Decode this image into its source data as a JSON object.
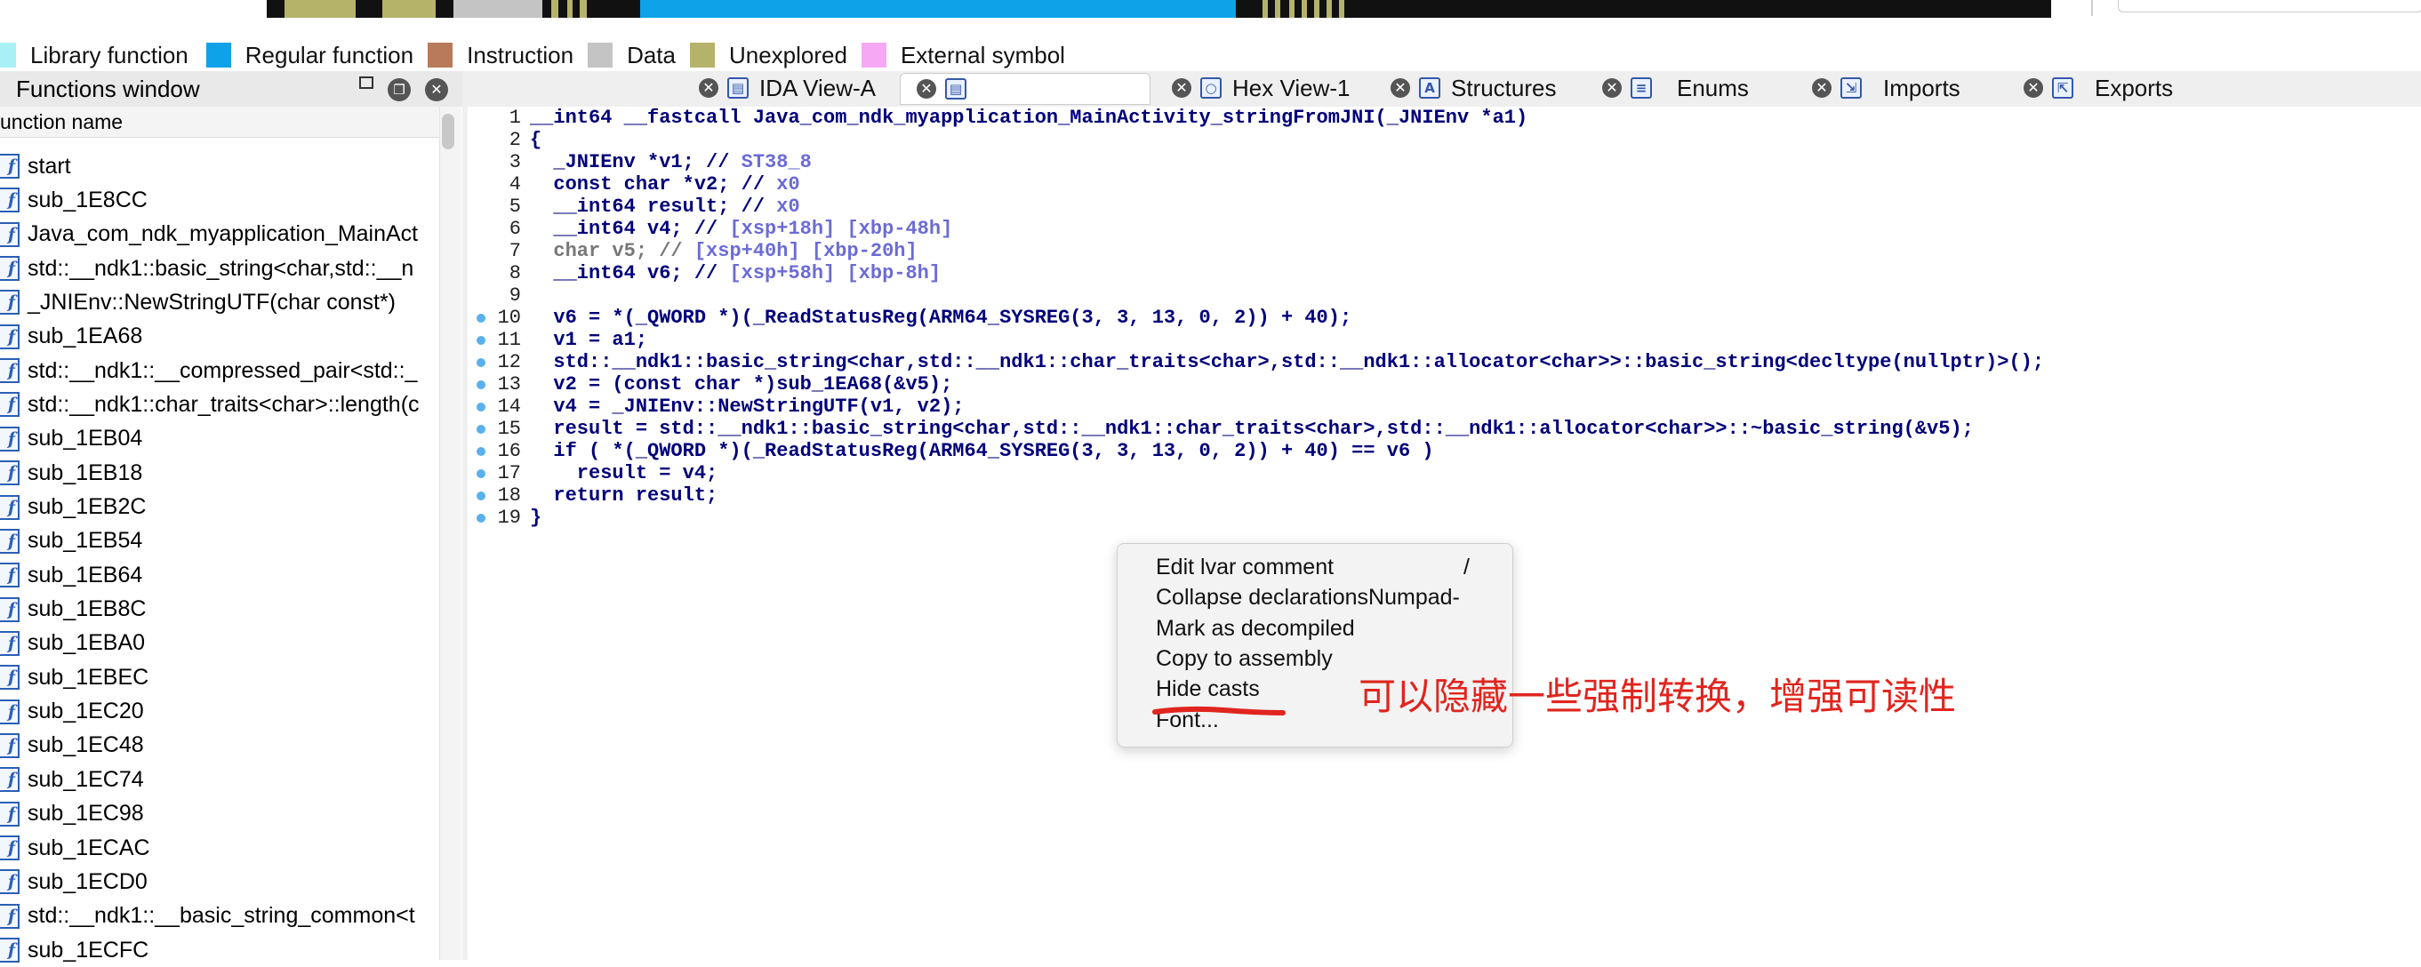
{
  "legend": [
    {
      "label": "Library function",
      "color": "#a8f0f5"
    },
    {
      "label": "Regular function",
      "color": "#0ea2e8"
    },
    {
      "label": "Instruction",
      "color": "#b87a5a"
    },
    {
      "label": "Data",
      "color": "#c4c4c4"
    },
    {
      "label": "Unexplored",
      "color": "#b5b36a"
    },
    {
      "label": "External symbol",
      "color": "#f7a8f4"
    }
  ],
  "functions_window": {
    "title": "Functions window",
    "column_header": "unction name",
    "items": [
      "start",
      "sub_1E8CC",
      "Java_com_ndk_myapplication_MainAct",
      "std::__ndk1::basic_string<char,std::__n",
      "_JNIEnv::NewStringUTF(char const*)",
      "sub_1EA68",
      "std::__ndk1::__compressed_pair<std::_",
      "std::__ndk1::char_traits<char>::length(c",
      "sub_1EB04",
      "sub_1EB18",
      "sub_1EB2C",
      "sub_1EB54",
      "sub_1EB64",
      "sub_1EB8C",
      "sub_1EBA0",
      "sub_1EBEC",
      "sub_1EC20",
      "sub_1EC48",
      "sub_1EC74",
      "sub_1EC98",
      "sub_1ECAC",
      "sub_1ECD0",
      "std::__ndk1::__basic_string_common<t",
      "sub_1ECFC"
    ]
  },
  "tabs": [
    {
      "label": "IDA View-A"
    },
    {
      "label": ""
    },
    {
      "label": "Hex View-1"
    },
    {
      "label": "Structures"
    },
    {
      "label": "Enums"
    },
    {
      "label": "Imports"
    },
    {
      "label": "Exports"
    }
  ],
  "code_lines": [
    {
      "n": "1",
      "text": "__int64 __fastcall Java_com_ndk_myapplication_MainActivity_stringFromJNI(_JNIEnv *a1)"
    },
    {
      "n": "2",
      "text": "{"
    },
    {
      "n": "3",
      "text": "  _JNIEnv *v1; // ",
      "var": "ST38_8"
    },
    {
      "n": "4",
      "text": "  const char *v2; // ",
      "var": "x0"
    },
    {
      "n": "5",
      "text": "  __int64 result; // ",
      "var": "x0"
    },
    {
      "n": "6",
      "text": "  __int64 v4; // ",
      "var": "[xsp+18h] [xbp-48h]"
    },
    {
      "n": "7",
      "text": "  char v5; // ",
      "var": "[xsp+40h] [xbp-20h]"
    },
    {
      "n": "8",
      "text": "  __int64 v6; // ",
      "var": "[xsp+58h] [xbp-8h]"
    },
    {
      "n": "9",
      "text": ""
    },
    {
      "n": "10",
      "text": "  v6 = *(_QWORD *)(_ReadStatusReg(ARM64_SYSREG(3, 3, 13, 0, 2)) + 40);"
    },
    {
      "n": "11",
      "text": "  v1 = a1;"
    },
    {
      "n": "12",
      "text": "  std::__ndk1::basic_string<char,std::__ndk1::char_traits<char>,std::__ndk1::allocator<char>>::basic_string<decltype(nullptr)>();"
    },
    {
      "n": "13",
      "text": "  v2 = (const char *)sub_1EA68(&v5);"
    },
    {
      "n": "14",
      "text": "  v4 = _JNIEnv::NewStringUTF(v1, v2);"
    },
    {
      "n": "15",
      "text": "  result = std::__ndk1::basic_string<char,std::__ndk1::char_traits<char>,std::__ndk1::allocator<char>>::~basic_string(&v5);"
    },
    {
      "n": "16",
      "text": "  if ( *(_QWORD *)(_ReadStatusReg(ARM64_SYSREG(3, 3, 13, 0, 2)) + 40) == v6 )"
    },
    {
      "n": "17",
      "text": "    result = v4;"
    },
    {
      "n": "18",
      "text": "  return result;"
    },
    {
      "n": "19",
      "text": "}"
    }
  ],
  "context_menu": {
    "items": [
      {
        "label": "Edit lvar comment",
        "shortcut": "/"
      },
      {
        "label": "Collapse declarations",
        "shortcut": "Numpad-"
      },
      {
        "label": "Mark as decompiled",
        "shortcut": ""
      },
      {
        "label": "Copy to assembly",
        "shortcut": ""
      },
      {
        "label": "Hide casts",
        "shortcut": ""
      },
      {
        "label": "Font...",
        "shortcut": ""
      }
    ]
  },
  "annotation": {
    "text": "可以隐藏一些强制转换，增强可读性",
    "color": "#e0251e"
  }
}
